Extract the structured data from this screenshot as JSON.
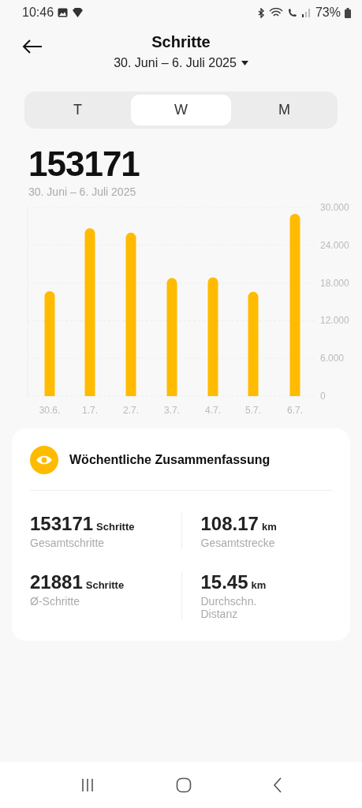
{
  "status_bar": {
    "time": "10:46",
    "battery": "73%"
  },
  "header": {
    "title": "Schritte",
    "date_range": "30. Juni – 6. Juli 2025"
  },
  "tabs": [
    {
      "label": "T",
      "selected": false
    },
    {
      "label": "W",
      "selected": true
    },
    {
      "label": "M",
      "selected": false
    }
  ],
  "total": {
    "value": "153171",
    "date_range": "30. Juni – 6. Juli 2025"
  },
  "chart_data": {
    "type": "bar",
    "categories": [
      "30.6.",
      "1.7.",
      "2.7.",
      "3.7.",
      "4.7.",
      "5.7.",
      "6.7."
    ],
    "series": [
      {
        "color": "#ffbb00",
        "values": [
          16.7,
          26.7,
          26.0,
          18.8,
          18.9,
          16.6,
          29.0
        ]
      }
    ],
    "ylim": [
      0,
      30
    ],
    "grid": true,
    "yticks": [
      {
        "value": 0,
        "label": "0"
      },
      {
        "value": 6,
        "label": "6.000"
      },
      {
        "value": 12,
        "label": "12.000"
      },
      {
        "value": 18,
        "label": "18.000"
      },
      {
        "value": 24,
        "label": "24.000"
      },
      {
        "value": 30,
        "label": "30.000"
      }
    ]
  },
  "summary": {
    "title": "Wöchentliche Zusammenfassung",
    "stats": [
      {
        "value": "153171",
        "unit": "Schritte",
        "label": "Gesamtschritte"
      },
      {
        "value": "108.17",
        "unit": "km",
        "label": "Gesamtstrecke"
      },
      {
        "value": "21881",
        "unit": "Schritte",
        "label": "Ø-Schritte"
      },
      {
        "value": "15.45",
        "unit": "km",
        "label": "Durchschn. Distanz"
      }
    ]
  }
}
